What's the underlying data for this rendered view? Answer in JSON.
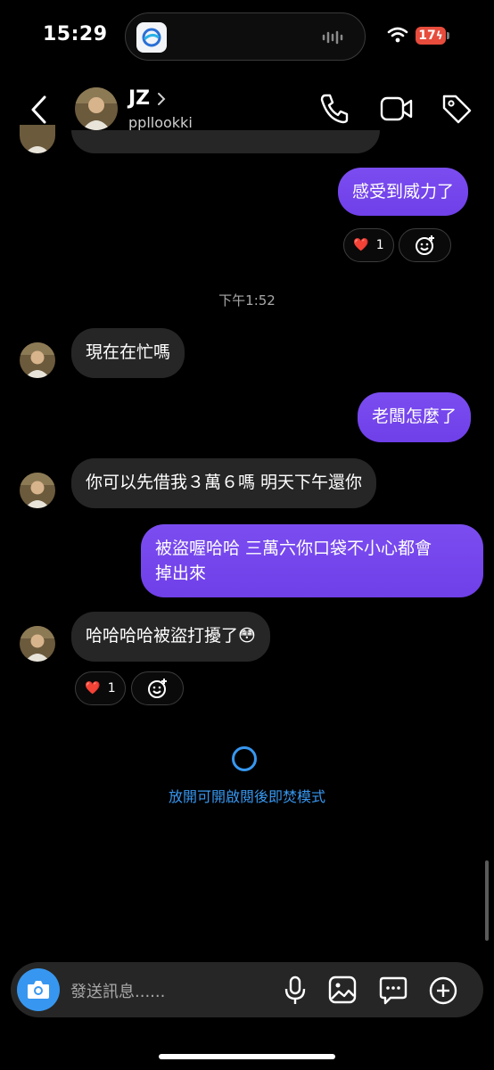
{
  "status_bar": {
    "time": "15:29",
    "battery": "17"
  },
  "header": {
    "name": "JZ",
    "username": "ppllookki"
  },
  "timestamp": "下午1:52",
  "messages": {
    "m1": "感受到威力了",
    "m2": "現在在忙嗎",
    "m3": "老闆怎麼了",
    "m4": "你可以先借我３萬６嗎 明天下午還你",
    "m5_line1": "被盜喔哈哈 三萬六你口袋不小心都會",
    "m5_line2": "掉出來",
    "m6": "哈哈哈哈被盜打擾了😳"
  },
  "reactions": {
    "r1": {
      "emoji": "❤️",
      "count": "1"
    },
    "r2": {
      "emoji": "❤️",
      "count": "1"
    }
  },
  "vanish_mode_text": "放開可開啟閱後即焚模式",
  "composer": {
    "placeholder": "發送訊息......"
  },
  "colors": {
    "accent_blue": "#3797f0",
    "outgoing_bubble": "#7445ec",
    "incoming_bubble": "#262626"
  },
  "icons": [
    "back-chevron-icon",
    "phone-icon",
    "video-icon",
    "tag-icon",
    "camera-icon",
    "microphone-icon",
    "image-icon",
    "sticker-chat-icon",
    "plus-circle-icon",
    "add-reaction-icon",
    "wifi-icon"
  ]
}
